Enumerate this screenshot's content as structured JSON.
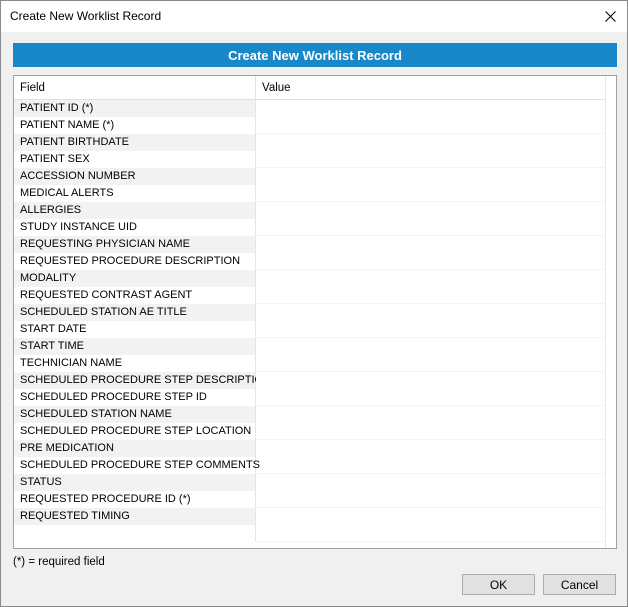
{
  "window": {
    "title": "Create New Worklist Record",
    "close_icon": "close-icon"
  },
  "header": {
    "label": "Create New Worklist Record",
    "color": "#1888c8"
  },
  "grid": {
    "columns": [
      "Field",
      "Value"
    ],
    "rows": [
      {
        "field": "PATIENT ID (*)",
        "value": ""
      },
      {
        "field": "PATIENT NAME (*)",
        "value": ""
      },
      {
        "field": "PATIENT BIRTHDATE",
        "value": ""
      },
      {
        "field": "PATIENT SEX",
        "value": ""
      },
      {
        "field": "ACCESSION NUMBER",
        "value": ""
      },
      {
        "field": "MEDICAL ALERTS",
        "value": ""
      },
      {
        "field": "ALLERGIES",
        "value": ""
      },
      {
        "field": "STUDY INSTANCE UID",
        "value": ""
      },
      {
        "field": "REQUESTING PHYSICIAN NAME",
        "value": ""
      },
      {
        "field": "REQUESTED PROCEDURE DESCRIPTION",
        "value": ""
      },
      {
        "field": "MODALITY",
        "value": ""
      },
      {
        "field": "REQUESTED CONTRAST AGENT",
        "value": ""
      },
      {
        "field": "SCHEDULED STATION AE TITLE",
        "value": ""
      },
      {
        "field": "START DATE",
        "value": ""
      },
      {
        "field": "START TIME",
        "value": ""
      },
      {
        "field": "TECHNICIAN NAME",
        "value": ""
      },
      {
        "field": "SCHEDULED PROCEDURE STEP DESCRIPTION",
        "value": ""
      },
      {
        "field": "SCHEDULED PROCEDURE STEP ID",
        "value": ""
      },
      {
        "field": "SCHEDULED STATION NAME",
        "value": ""
      },
      {
        "field": "SCHEDULED PROCEDURE STEP LOCATION",
        "value": ""
      },
      {
        "field": "PRE MEDICATION",
        "value": ""
      },
      {
        "field": "SCHEDULED PROCEDURE STEP COMMENTS",
        "value": ""
      },
      {
        "field": "STATUS",
        "value": ""
      },
      {
        "field": "REQUESTED PROCEDURE ID (*)",
        "value": ""
      },
      {
        "field": "REQUESTED TIMING",
        "value": ""
      }
    ]
  },
  "footnote": "(*) = required field",
  "buttons": {
    "ok": "OK",
    "cancel": "Cancel"
  }
}
